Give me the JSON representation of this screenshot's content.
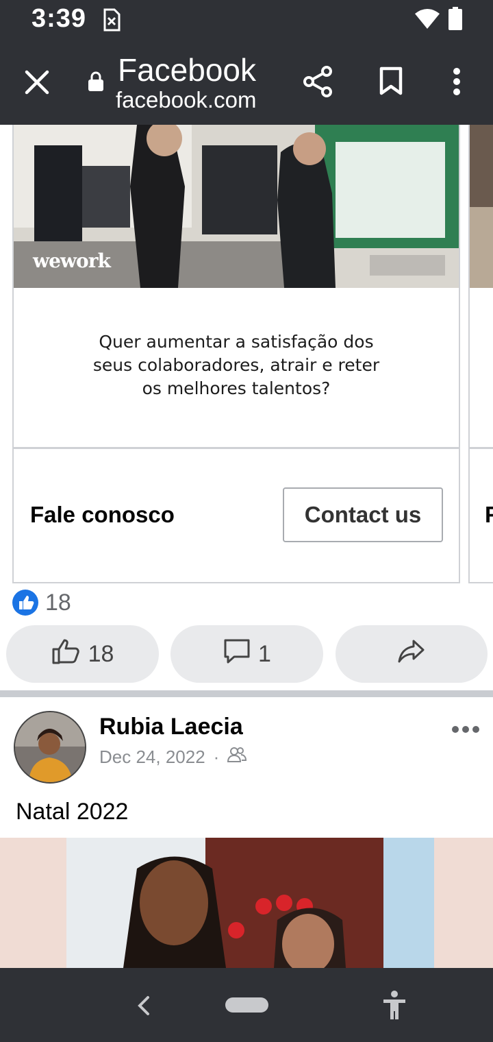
{
  "status_bar": {
    "time": "3:39"
  },
  "browser": {
    "title": "Facebook",
    "url": "facebook.com"
  },
  "ad_card": {
    "brand": "wework",
    "tagline": "Quer aumentar a satisfação dos\nseus colaboradores, atrair e reter\nos melhores  talentos?",
    "cta_text": "Fale conosco",
    "cta_button": "Contact us",
    "next_card_cta_initial": "F"
  },
  "reactions": {
    "like_total": "18",
    "like_button_count": "18",
    "comment_count": "1"
  },
  "post": {
    "author": "Rubia Laecia",
    "date": "Dec 24, 2022",
    "separator": "·",
    "audience_icon": "friends-icon",
    "text": "Natal 2022"
  },
  "colors": {
    "bar_bg": "#2f3136",
    "like_blue": "#1b74e4",
    "pill_bg": "#e9eaec"
  }
}
